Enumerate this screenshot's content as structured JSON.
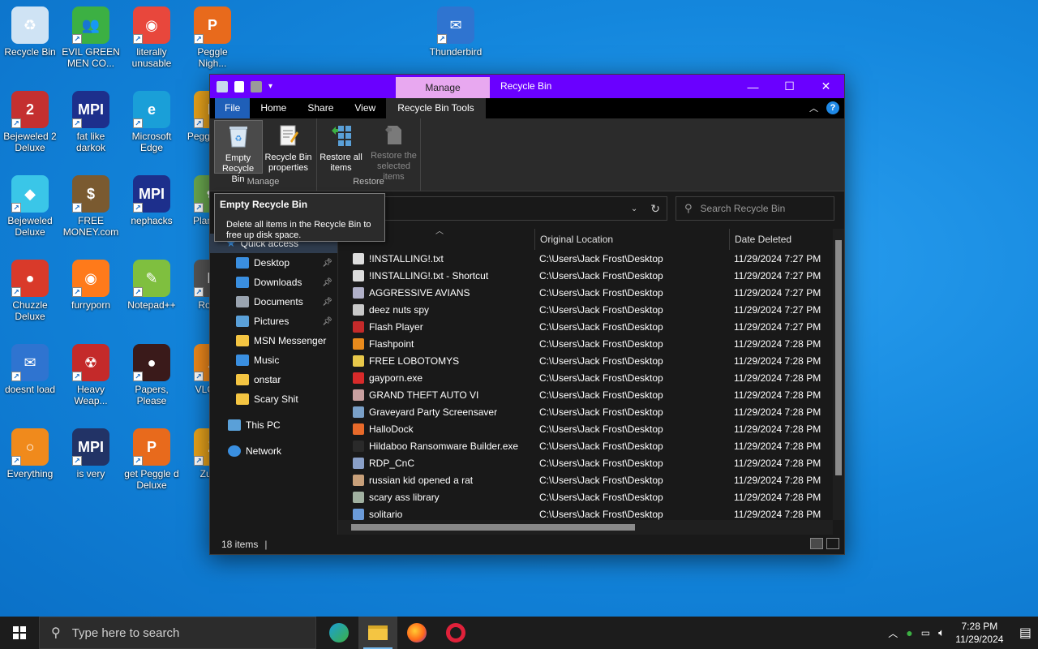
{
  "desktop": {
    "icons": [
      {
        "label": "Recycle Bin",
        "color": "#cfe3f4",
        "glyph": "♻"
      },
      {
        "label": "EVIL GREEN MEN CO...",
        "color": "#3cb043",
        "glyph": "👥"
      },
      {
        "label": "literally unusable",
        "color": "#e8473c",
        "glyph": "◉"
      },
      {
        "label": "Peggle Nigh...",
        "color": "#e86a1c",
        "glyph": "P"
      },
      {
        "label": "Thunderbird",
        "color": "#2f74d0",
        "glyph": "✉"
      },
      {
        "label": "Bejeweled 2 Deluxe",
        "color": "#c43030",
        "glyph": "2"
      },
      {
        "label": "fat like darkok",
        "color": "#1d2f8c",
        "glyph": "MPI"
      },
      {
        "label": "Microsoft Edge",
        "color": "#1a9fd8",
        "glyph": "e"
      },
      {
        "label": "Pegg of Wa",
        "color": "#e8a31c",
        "glyph": "P"
      },
      {
        "label": "Bejeweled Deluxe",
        "color": "#3ac6e8",
        "glyph": "◆"
      },
      {
        "label": "FREE MONEY.com",
        "color": "#7a5a30",
        "glyph": "$"
      },
      {
        "label": "nephacks",
        "color": "#1d2f8c",
        "glyph": "MPI"
      },
      {
        "label": "Plan Zon",
        "color": "#6aa84f",
        "glyph": "✿"
      },
      {
        "label": "Chuzzle Deluxe",
        "color": "#d93a2a",
        "glyph": "●"
      },
      {
        "label": "furryporn",
        "color": "#ff7a1a",
        "glyph": "◉"
      },
      {
        "label": "Notepad++",
        "color": "#7fbf3f",
        "glyph": "✎"
      },
      {
        "label": "Ro Ma",
        "color": "#555555",
        "glyph": "R"
      },
      {
        "label": "doesnt load",
        "color": "#2f74d0",
        "glyph": "✉"
      },
      {
        "label": "Heavy Weap...",
        "color": "#c42a2a",
        "glyph": "☢"
      },
      {
        "label": "Papers, Please",
        "color": "#3a1a1a",
        "glyph": "●"
      },
      {
        "label": "VLC pla",
        "color": "#f08a1c",
        "glyph": "▲"
      },
      {
        "label": "Everything",
        "color": "#f08a1c",
        "glyph": "○"
      },
      {
        "label": "is very",
        "color": "#223366",
        "glyph": "MPI"
      },
      {
        "label": "get Peggle d Deluxe",
        "color": "#e86a1c",
        "glyph": "P"
      },
      {
        "label": "Zuma",
        "color": "#e8a31c",
        "glyph": "Z"
      }
    ]
  },
  "window": {
    "title": "Recycle Bin",
    "context_tab": "Manage",
    "controls": {
      "minimize": "—",
      "maximize": "☐",
      "close": "✕"
    },
    "ribbon_tabs": [
      "File",
      "Home",
      "Share",
      "View",
      "Recycle Bin Tools"
    ],
    "ribbon": {
      "manage_group": "Manage",
      "restore_group": "Restore",
      "empty_bin": "Empty Recycle Bin",
      "properties": "Recycle Bin properties",
      "restore_all": "Restore all items",
      "restore_selected": "Restore the selected items"
    },
    "search_placeholder": "Search Recycle Bin",
    "tooltip": {
      "title": "Empty Recycle Bin",
      "desc": "Delete all items in the Recycle Bin to free up disk space."
    },
    "nav": {
      "quick_access": "Quick access",
      "items": [
        {
          "label": "Desktop",
          "pinned": true,
          "color": "#3a8fe0"
        },
        {
          "label": "Downloads",
          "pinned": true,
          "color": "#3a8fe0"
        },
        {
          "label": "Documents",
          "pinned": true,
          "color": "#9aa4b0"
        },
        {
          "label": "Pictures",
          "pinned": true,
          "color": "#5aa0d8"
        },
        {
          "label": "MSN Messenger",
          "pinned": false,
          "color": "#f4c542"
        },
        {
          "label": "Music",
          "pinned": false,
          "color": "#3a8fe0"
        },
        {
          "label": "onstar",
          "pinned": false,
          "color": "#f4c542"
        },
        {
          "label": "Scary Shit",
          "pinned": false,
          "color": "#f4c542"
        }
      ],
      "this_pc": "This PC",
      "network": "Network"
    },
    "columns": {
      "name": "Name",
      "location": "Original Location",
      "date": "Date Deleted"
    },
    "files": [
      {
        "name": "!INSTALLING!.txt",
        "loc": "C:\\Users\\Jack Frost\\Desktop",
        "date": "11/29/2024 7:27 PM",
        "color": "#dddddd"
      },
      {
        "name": "!INSTALLING!.txt - Shortcut",
        "loc": "C:\\Users\\Jack Frost\\Desktop",
        "date": "11/29/2024 7:27 PM",
        "color": "#dddddd"
      },
      {
        "name": "AGGRESSIVE AVIANS",
        "loc": "C:\\Users\\Jack Frost\\Desktop",
        "date": "11/29/2024 7:27 PM",
        "color": "#b0b0c8"
      },
      {
        "name": "deez nuts spy",
        "loc": "C:\\Users\\Jack Frost\\Desktop",
        "date": "11/29/2024 7:27 PM",
        "color": "#c8c8c8"
      },
      {
        "name": "Flash Player",
        "loc": "C:\\Users\\Jack Frost\\Desktop",
        "date": "11/29/2024 7:27 PM",
        "color": "#c42a2a"
      },
      {
        "name": "Flashpoint",
        "loc": "C:\\Users\\Jack Frost\\Desktop",
        "date": "11/29/2024 7:28 PM",
        "color": "#e88a1c"
      },
      {
        "name": "FREE LOBOTOMYS",
        "loc": "C:\\Users\\Jack Frost\\Desktop",
        "date": "11/29/2024 7:28 PM",
        "color": "#e8c84a"
      },
      {
        "name": "gayporn.exe",
        "loc": "C:\\Users\\Jack Frost\\Desktop",
        "date": "11/29/2024 7:28 PM",
        "color": "#d82a2a"
      },
      {
        "name": "GRAND THEFT AUTO VI",
        "loc": "C:\\Users\\Jack Frost\\Desktop",
        "date": "11/29/2024 7:28 PM",
        "color": "#c8a0a0"
      },
      {
        "name": "Graveyard Party Screensaver",
        "loc": "C:\\Users\\Jack Frost\\Desktop",
        "date": "11/29/2024 7:28 PM",
        "color": "#7aa0c8"
      },
      {
        "name": "HalloDock",
        "loc": "C:\\Users\\Jack Frost\\Desktop",
        "date": "11/29/2024 7:28 PM",
        "color": "#e86a2a"
      },
      {
        "name": "Hildaboo Ransomware Builder.exe",
        "loc": "C:\\Users\\Jack Frost\\Desktop",
        "date": "11/29/2024 7:28 PM",
        "color": "#2a2a2a"
      },
      {
        "name": "RDP_CnC",
        "loc": "C:\\Users\\Jack Frost\\Desktop",
        "date": "11/29/2024 7:28 PM",
        "color": "#8aa0c8"
      },
      {
        "name": "russian kid opened a rat",
        "loc": "C:\\Users\\Jack Frost\\Desktop",
        "date": "11/29/2024 7:28 PM",
        "color": "#c8a07a"
      },
      {
        "name": "scary ass library",
        "loc": "C:\\Users\\Jack Frost\\Desktop",
        "date": "11/29/2024 7:28 PM",
        "color": "#a0b0a0"
      },
      {
        "name": "solitario",
        "loc": "C:\\Users\\Jack Frost\\Desktop",
        "date": "11/29/2024 7:28 PM",
        "color": "#6a9ad8"
      }
    ],
    "status": "18 items"
  },
  "taskbar": {
    "search_placeholder": "Type here to search",
    "time": "7:28 PM",
    "date": "11/29/2024"
  }
}
